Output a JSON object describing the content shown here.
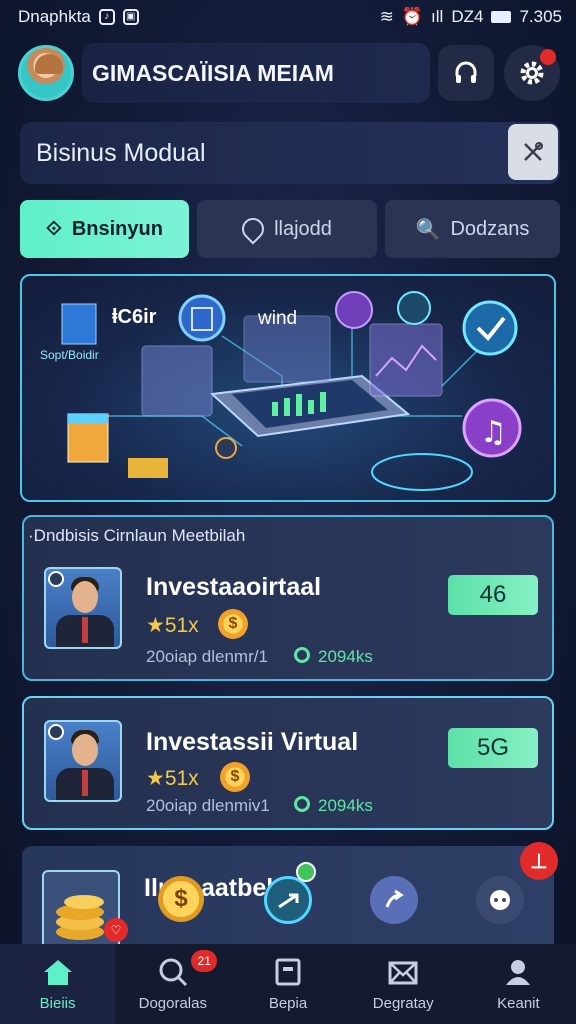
{
  "status_bar": {
    "carrier": "Dnaphkta",
    "signal_text": "Ꮗ Ꮳ Ꭵ",
    "network_text": "DZ4",
    "time": "7.305"
  },
  "header": {
    "title": "GIMASCAЇISIA MEIAM"
  },
  "module_bar": {
    "label": "Bisinus Modual"
  },
  "tabs": [
    {
      "label": "Bnsinyun",
      "active": true
    },
    {
      "label": "llajodd",
      "active": false
    },
    {
      "label": "Dodzans",
      "active": false
    }
  ],
  "banner": {
    "text_left": "ⱡC6ir",
    "text_right": "wind",
    "text_small": "Sopt/Boidir"
  },
  "section": {
    "label": "·Dndbisis Cirnlaun Meetbilah"
  },
  "cards": [
    {
      "title": "Investaaoirtaal",
      "rating": "★51x",
      "meta": "20oiap dlenmr/1",
      "count": "2094ks",
      "score": "46"
    },
    {
      "title": "Investassii Virtual",
      "rating": "★51x",
      "meta": "20oiap dlenmiv1",
      "count": "2094ks",
      "score": "5G"
    },
    {
      "title": "Ilnseaatbelde"
    }
  ],
  "bottom_nav": [
    {
      "label": "Bieiis",
      "active": true
    },
    {
      "label": "Dogoralas",
      "badge": "21"
    },
    {
      "label": "Bepia"
    },
    {
      "label": "Degratay"
    },
    {
      "label": "Keanit"
    }
  ],
  "colors": {
    "accent": "#5ff0c8",
    "card_border": "#5cc9ea",
    "badge_red": "#e12b2b",
    "background": "#121a36"
  }
}
